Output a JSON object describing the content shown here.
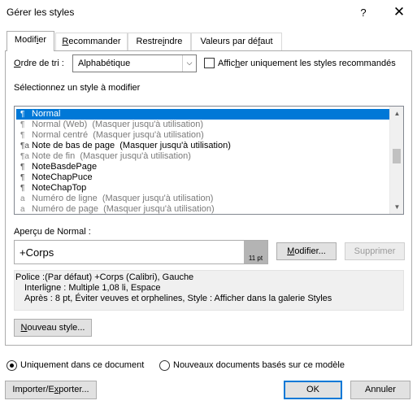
{
  "window": {
    "title": "Gérer les styles",
    "help": "?",
    "close": "✕"
  },
  "tabs": [
    {
      "label": "Modifier",
      "u": "i",
      "pre": "Modif",
      "post": "er"
    },
    {
      "label": "Recommander",
      "pre": "",
      "u": "R",
      "post": "ecommander"
    },
    {
      "label": "Restreindre",
      "pre": "Restre",
      "u": "i",
      "post": "ndre"
    },
    {
      "label": "Valeurs par défaut",
      "pre": "Valeurs par dé",
      "u": "f",
      "post": "aut"
    }
  ],
  "sort": {
    "label_pre": "O",
    "label_post": "rdre de tri :",
    "value": "Alphabétique",
    "arrow": "⌵",
    "only_recommended_pre": "Affic",
    "only_recommended_u": "h",
    "only_recommended_post": "er uniquement les styles recommandés"
  },
  "select_label": "Sélectionnez un style à modifier",
  "styles_list": [
    {
      "icon": "¶",
      "name": "Normal",
      "hint": "",
      "state": "selected"
    },
    {
      "icon": "¶",
      "name": "Normal (Web)",
      "hint": "(Masquer jusqu'à utilisation)",
      "state": "gray"
    },
    {
      "icon": "¶",
      "name": "Normal centré",
      "hint": "(Masquer jusqu'à utilisation)",
      "state": "gray"
    },
    {
      "icon": "¶a",
      "name": "Note de bas de page",
      "hint": "(Masquer jusqu'à utilisation)",
      "state": "normal"
    },
    {
      "icon": "¶a",
      "name": "Note de fin",
      "hint": "(Masquer jusqu'à utilisation)",
      "state": "gray"
    },
    {
      "icon": "¶",
      "name": "NoteBasdePage",
      "hint": "",
      "state": "normal"
    },
    {
      "icon": "¶",
      "name": "NoteChapPuce",
      "hint": "",
      "state": "normal"
    },
    {
      "icon": "¶",
      "name": "NoteChapTop",
      "hint": "",
      "state": "normal"
    },
    {
      "icon": "a",
      "name": "Numéro de ligne",
      "hint": "(Masquer jusqu'à utilisation)",
      "state": "gray"
    },
    {
      "icon": "a",
      "name": "Numéro de page",
      "hint": "(Masquer jusqu'à utilisation)",
      "state": "gray"
    }
  ],
  "scroll": {
    "up": "▲",
    "down": "▼",
    "position": 0.42
  },
  "preview": {
    "label": "Aperçu de Normal :",
    "text": "+Corps",
    "size": "11 pt"
  },
  "buttons": {
    "modify_pre": "",
    "modify_u": "M",
    "modify_post": "odifier...",
    "delete": "Supprimer",
    "new_style_pre": "",
    "new_style_u": "N",
    "new_style_post": "ouveau style...",
    "import_export_pre": "Importer/E",
    "import_export_u": "x",
    "import_export_post": "porter...",
    "ok": "OK",
    "cancel": "Annuler"
  },
  "description": {
    "line1": "Police :(Par défaut) +Corps (Calibri), Gauche",
    "line2": "Interligne : Multiple 1,08 li, Espace",
    "line3": "Après : 8 pt, Éviter veuves et orphelines, Style : Afficher dans la galerie Styles"
  },
  "scope": {
    "doc_only": "Uniquement dans ce document",
    "new_docs": "Nouveaux documents basés sur ce modèle",
    "selected": "doc_only"
  }
}
